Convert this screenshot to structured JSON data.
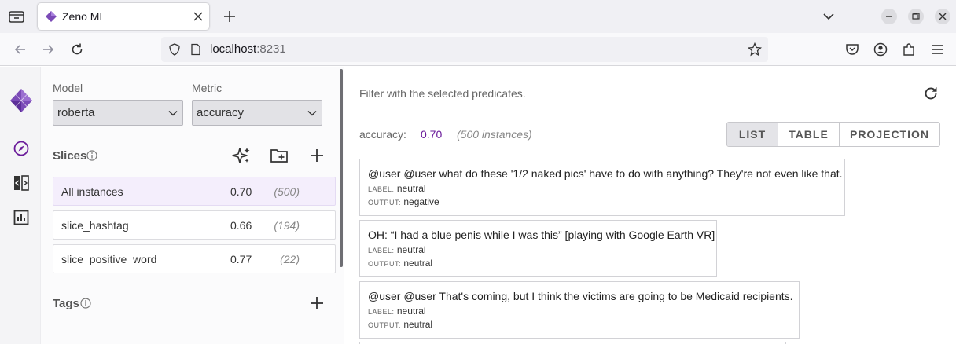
{
  "browser": {
    "tab_title": "Zeno ML",
    "url_host": "localhost",
    "url_port": ":8231"
  },
  "sidebar": {
    "model_label": "Model",
    "model_value": "roberta",
    "metric_label": "Metric",
    "metric_value": "accuracy",
    "slices_title": "Slices",
    "slices": [
      {
        "name": "All instances",
        "metric": "0.70",
        "count": "(500)"
      },
      {
        "name": "slice_hashtag",
        "metric": "0.66",
        "count": "(194)"
      },
      {
        "name": "slice_positive_word",
        "metric": "0.77",
        "count": "(22)"
      }
    ],
    "tags_title": "Tags"
  },
  "main": {
    "filter_text": "Filter with the selected predicates.",
    "metric_label": "accuracy:",
    "metric_value": "0.70",
    "instance_count": "(500 instances)",
    "views": [
      "LIST",
      "TABLE",
      "PROJECTION"
    ],
    "active_view": "LIST",
    "label_key": "LABEL:",
    "output_key": "OUTPUT:",
    "instances": [
      {
        "text": "@user @user what do these '1/2 naked pics' have to do with anything? They're not even like that.",
        "label": "neutral",
        "output": "negative"
      },
      {
        "text": "OH: “I had a blue penis while I was this” [playing with Google Earth VR]",
        "label": "neutral",
        "output": "neutral"
      },
      {
        "text": "@user @user That's coming, but I think the victims are going to be Medicaid recipients.",
        "label": "neutral",
        "output": "neutral"
      }
    ]
  },
  "colors": {
    "accent": "#6a1b9a",
    "selected_row": "#f4eefc"
  }
}
